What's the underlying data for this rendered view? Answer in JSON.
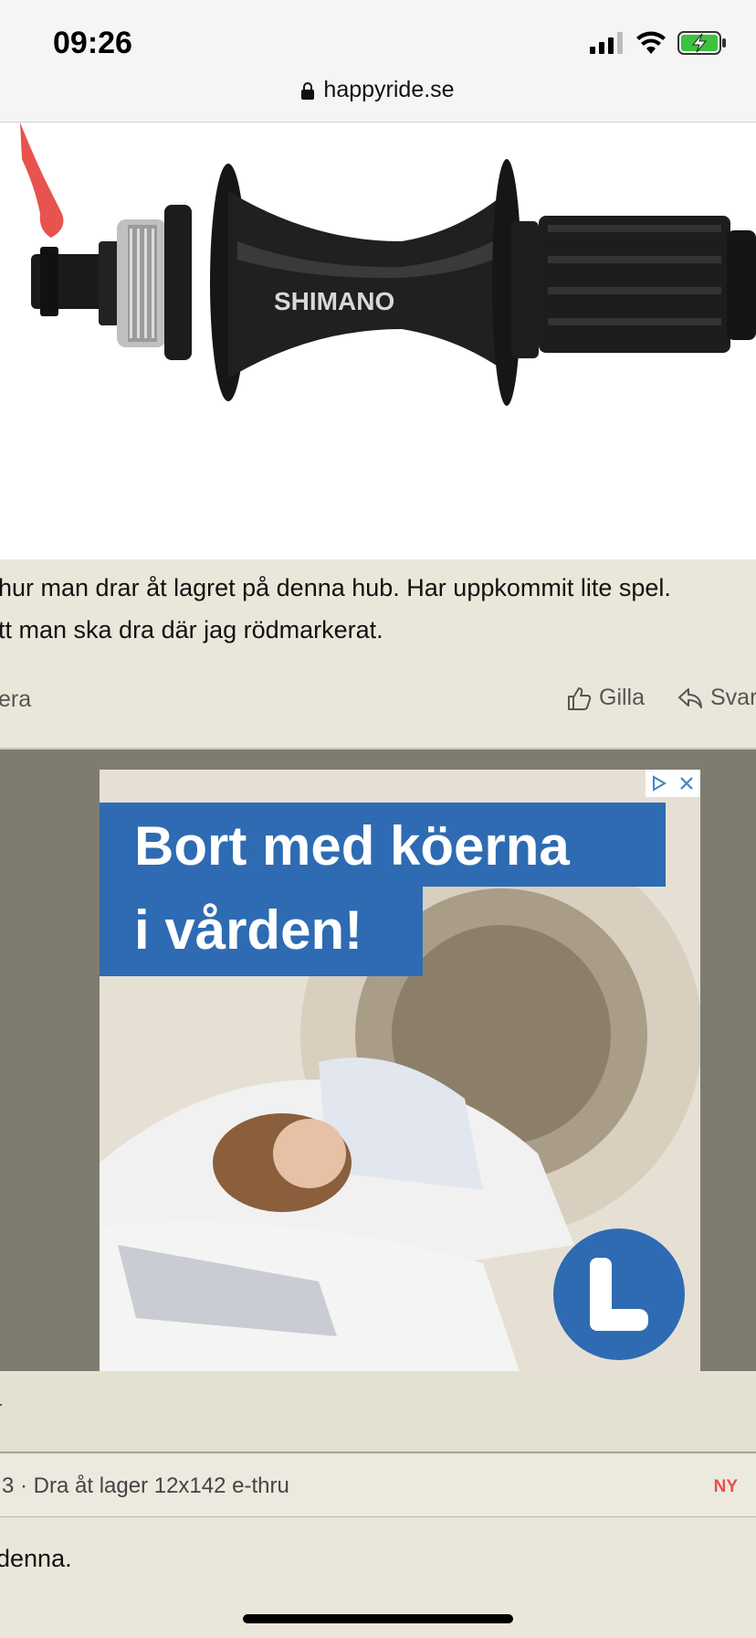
{
  "status_bar": {
    "time": "09:26",
    "url": "happyride.se",
    "icons": [
      "signal-icon",
      "wifi-icon",
      "battery-charging-icon"
    ]
  },
  "product": {
    "brand_text": "SHIMANO"
  },
  "post": {
    "line1": "hur man drar åt lagret på denna hub. Har uppkommit lite spel.",
    "line2": "tt man ska dra där jag rödmarkerat.",
    "left_action": "era",
    "like_label": "Gilla",
    "reply_label": "Svar"
  },
  "ad": {
    "headline_line1": "Bort med köerna",
    "headline_line2": "i vården!",
    "brand_color": "#2e6bb2"
  },
  "thread": {
    "title": "3 · Dra åt lager 12x142 e-thru",
    "badge": "NY"
  },
  "reply_preview": "denna."
}
